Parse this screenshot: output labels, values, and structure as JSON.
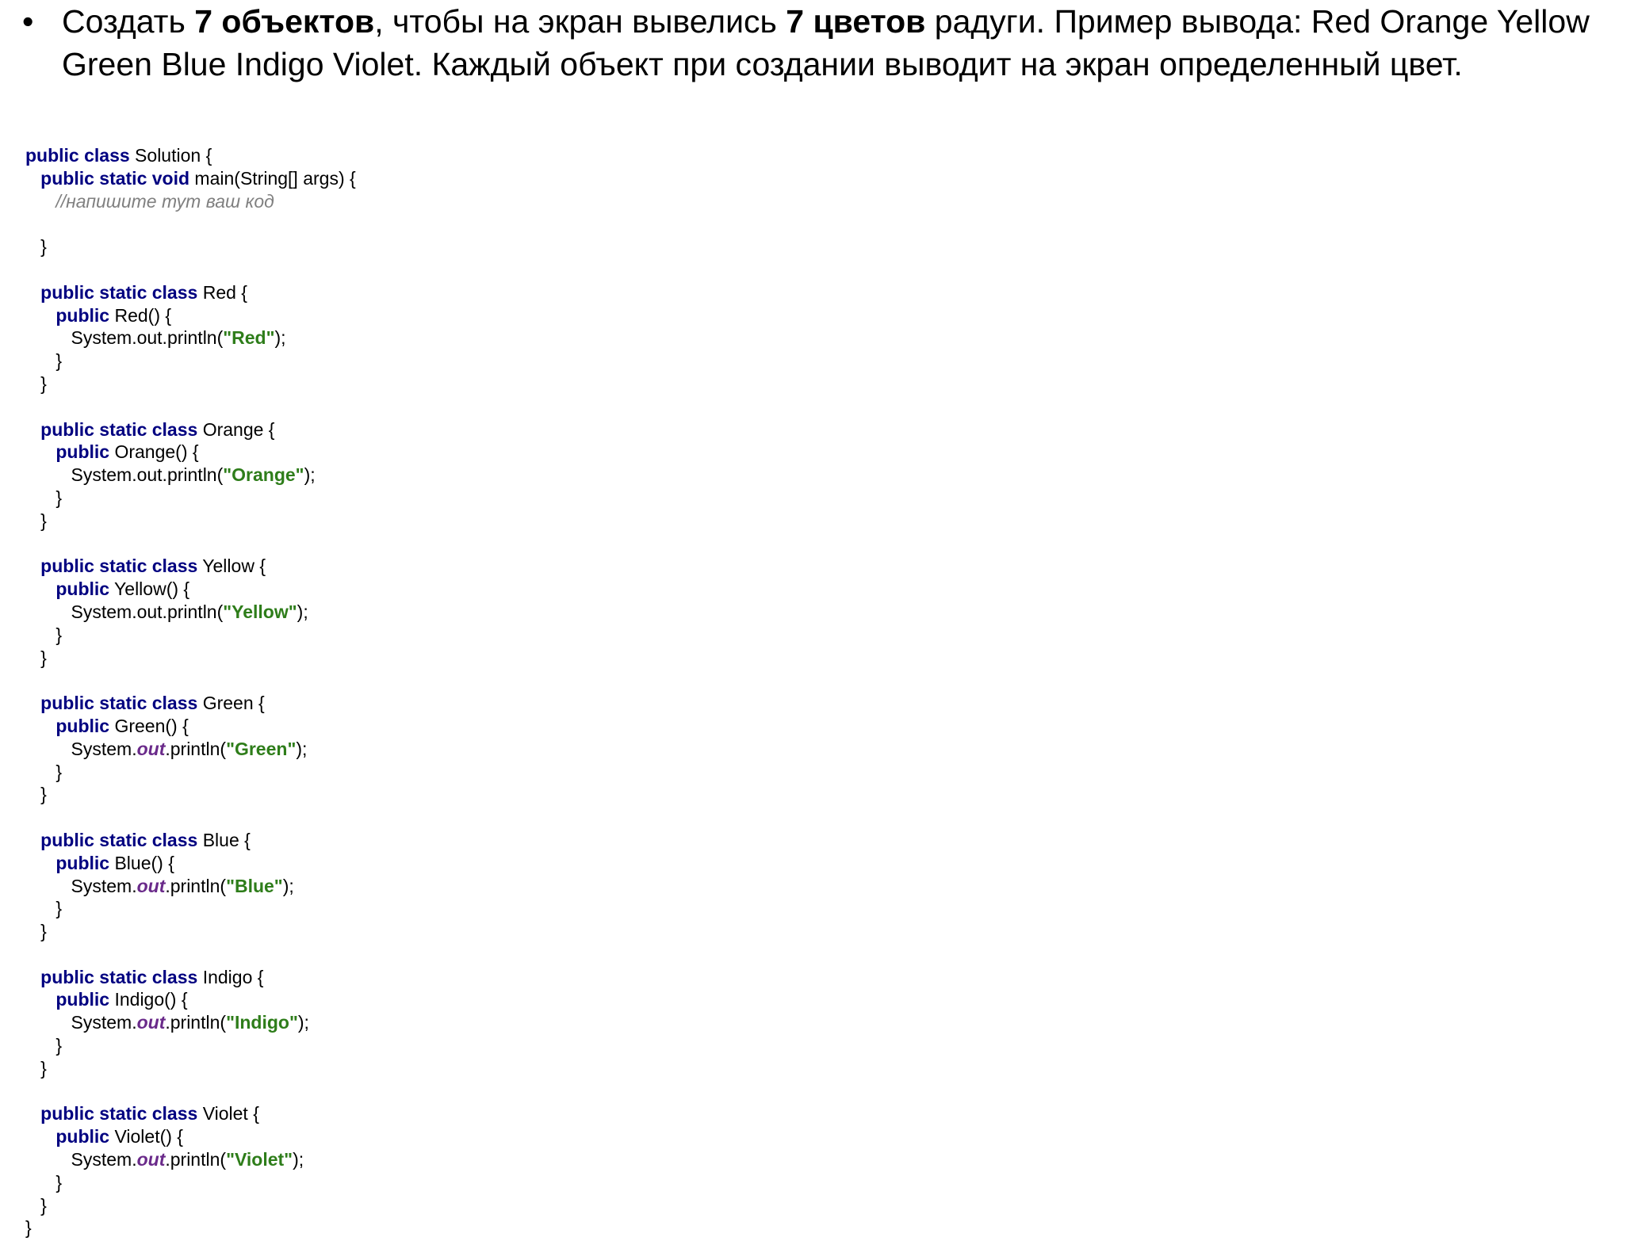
{
  "task": {
    "bullet": "•",
    "p1": "Создать ",
    "b1": "7 объектов",
    "p2": ", чтобы на экран вывелись ",
    "b2": "7 цветов",
    "p3": " радуги. Пример вывода: Red Orange Yellow Green Blue Indigo Violet. Каждый объект при создании выводит на экран определенный цвет."
  },
  "code": {
    "lines": [
      [
        {
          "t": "kw",
          "v": "public class"
        },
        {
          "t": "p",
          "v": " Solution {"
        }
      ],
      [
        {
          "t": "p",
          "v": "   "
        },
        {
          "t": "kw",
          "v": "public static void"
        },
        {
          "t": "p",
          "v": " main(String[] args) {"
        }
      ],
      [
        {
          "t": "p",
          "v": "      "
        },
        {
          "t": "cmt",
          "v": "//напишите тут ваш код"
        }
      ],
      [],
      [
        {
          "t": "p",
          "v": "   }"
        }
      ],
      [],
      [
        {
          "t": "p",
          "v": "   "
        },
        {
          "t": "kw",
          "v": "public static class"
        },
        {
          "t": "p",
          "v": " Red {"
        }
      ],
      [
        {
          "t": "p",
          "v": "      "
        },
        {
          "t": "kw",
          "v": "public"
        },
        {
          "t": "p",
          "v": " Red() {"
        }
      ],
      [
        {
          "t": "p",
          "v": "         System.out.println("
        },
        {
          "t": "str",
          "v": "\"Red\""
        },
        {
          "t": "p",
          "v": ");"
        }
      ],
      [
        {
          "t": "p",
          "v": "      }"
        }
      ],
      [
        {
          "t": "p",
          "v": "   }"
        }
      ],
      [],
      [
        {
          "t": "p",
          "v": "   "
        },
        {
          "t": "kw",
          "v": "public static class"
        },
        {
          "t": "p",
          "v": " Orange {"
        }
      ],
      [
        {
          "t": "p",
          "v": "      "
        },
        {
          "t": "kw",
          "v": "public"
        },
        {
          "t": "p",
          "v": " Orange() {"
        }
      ],
      [
        {
          "t": "p",
          "v": "         System.out.println("
        },
        {
          "t": "str",
          "v": "\"Orange\""
        },
        {
          "t": "p",
          "v": ");"
        }
      ],
      [
        {
          "t": "p",
          "v": "      }"
        }
      ],
      [
        {
          "t": "p",
          "v": "   }"
        }
      ],
      [],
      [
        {
          "t": "p",
          "v": "   "
        },
        {
          "t": "kw",
          "v": "public static class"
        },
        {
          "t": "p",
          "v": " Yellow {"
        }
      ],
      [
        {
          "t": "p",
          "v": "      "
        },
        {
          "t": "kw",
          "v": "public"
        },
        {
          "t": "p",
          "v": " Yellow() {"
        }
      ],
      [
        {
          "t": "p",
          "v": "         System.out.println("
        },
        {
          "t": "str",
          "v": "\"Yellow\""
        },
        {
          "t": "p",
          "v": ");"
        }
      ],
      [
        {
          "t": "p",
          "v": "      }"
        }
      ],
      [
        {
          "t": "p",
          "v": "   }"
        }
      ],
      [],
      [
        {
          "t": "p",
          "v": "   "
        },
        {
          "t": "kw",
          "v": "public static class"
        },
        {
          "t": "p",
          "v": " Green {"
        }
      ],
      [
        {
          "t": "p",
          "v": "      "
        },
        {
          "t": "kw",
          "v": "public"
        },
        {
          "t": "p",
          "v": " Green() {"
        }
      ],
      [
        {
          "t": "p",
          "v": "         System."
        },
        {
          "t": "fld",
          "v": "out"
        },
        {
          "t": "p",
          "v": ".println("
        },
        {
          "t": "str",
          "v": "\"Green\""
        },
        {
          "t": "p",
          "v": ");"
        }
      ],
      [
        {
          "t": "p",
          "v": "      }"
        }
      ],
      [
        {
          "t": "p",
          "v": "   }"
        }
      ],
      [],
      [
        {
          "t": "p",
          "v": "   "
        },
        {
          "t": "kw",
          "v": "public static class"
        },
        {
          "t": "p",
          "v": " Blue {"
        }
      ],
      [
        {
          "t": "p",
          "v": "      "
        },
        {
          "t": "kw",
          "v": "public"
        },
        {
          "t": "p",
          "v": " Blue() {"
        }
      ],
      [
        {
          "t": "p",
          "v": "         System."
        },
        {
          "t": "fld",
          "v": "out"
        },
        {
          "t": "p",
          "v": ".println("
        },
        {
          "t": "str",
          "v": "\"Blue\""
        },
        {
          "t": "p",
          "v": ");"
        }
      ],
      [
        {
          "t": "p",
          "v": "      }"
        }
      ],
      [
        {
          "t": "p",
          "v": "   }"
        }
      ],
      [],
      [
        {
          "t": "p",
          "v": "   "
        },
        {
          "t": "kw",
          "v": "public static class"
        },
        {
          "t": "p",
          "v": " Indigo {"
        }
      ],
      [
        {
          "t": "p",
          "v": "      "
        },
        {
          "t": "kw",
          "v": "public"
        },
        {
          "t": "p",
          "v": " Indigo() {"
        }
      ],
      [
        {
          "t": "p",
          "v": "         System."
        },
        {
          "t": "fld",
          "v": "out"
        },
        {
          "t": "p",
          "v": ".println("
        },
        {
          "t": "str",
          "v": "\"Indigo\""
        },
        {
          "t": "p",
          "v": ");"
        }
      ],
      [
        {
          "t": "p",
          "v": "      }"
        }
      ],
      [
        {
          "t": "p",
          "v": "   }"
        }
      ],
      [],
      [
        {
          "t": "p",
          "v": "   "
        },
        {
          "t": "kw",
          "v": "public static class"
        },
        {
          "t": "p",
          "v": " Violet {"
        }
      ],
      [
        {
          "t": "p",
          "v": "      "
        },
        {
          "t": "kw",
          "v": "public"
        },
        {
          "t": "p",
          "v": " Violet() {"
        }
      ],
      [
        {
          "t": "p",
          "v": "         System."
        },
        {
          "t": "fld",
          "v": "out"
        },
        {
          "t": "p",
          "v": ".println("
        },
        {
          "t": "str",
          "v": "\"Violet\""
        },
        {
          "t": "p",
          "v": ");"
        }
      ],
      [
        {
          "t": "p",
          "v": "      }"
        }
      ],
      [
        {
          "t": "p",
          "v": "   }"
        }
      ],
      [
        {
          "t": "p",
          "v": "}"
        }
      ]
    ]
  }
}
